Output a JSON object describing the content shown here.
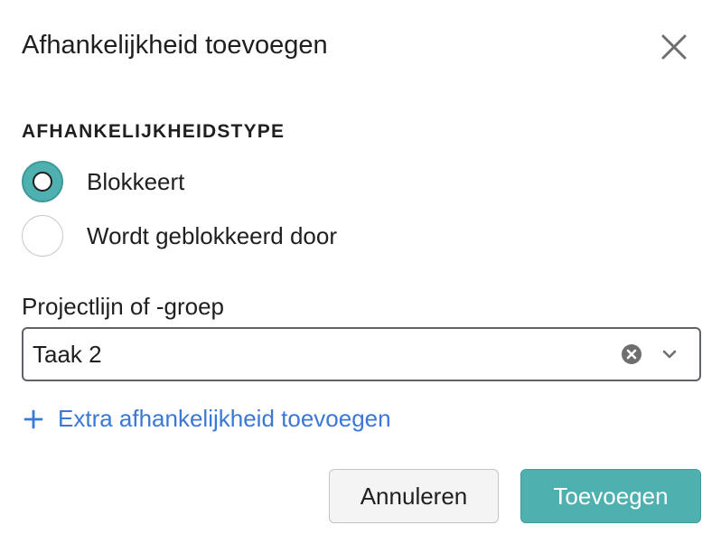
{
  "dialog": {
    "title": "Afhankelijkheid toevoegen",
    "close_icon": "close-icon"
  },
  "dependency_type": {
    "label": "AFHANKELIJKHEIDSTYPE",
    "options": [
      {
        "label": "Blokkeert",
        "checked": true
      },
      {
        "label": "Wordt geblokkeerd door",
        "checked": false
      }
    ]
  },
  "project_line": {
    "label": "Projectlijn of -groep",
    "value": "Taak 2",
    "clear_icon": "clear-circle-icon",
    "dropdown_icon": "chevron-down-icon"
  },
  "add_extra": {
    "label": "Extra afhankelijkheid toevoegen",
    "icon": "plus-icon"
  },
  "buttons": {
    "cancel": "Annuleren",
    "submit": "Toevoegen"
  },
  "colors": {
    "accent": "#4fb0b0",
    "link": "#3a78d6",
    "text": "#1f1f1f"
  }
}
